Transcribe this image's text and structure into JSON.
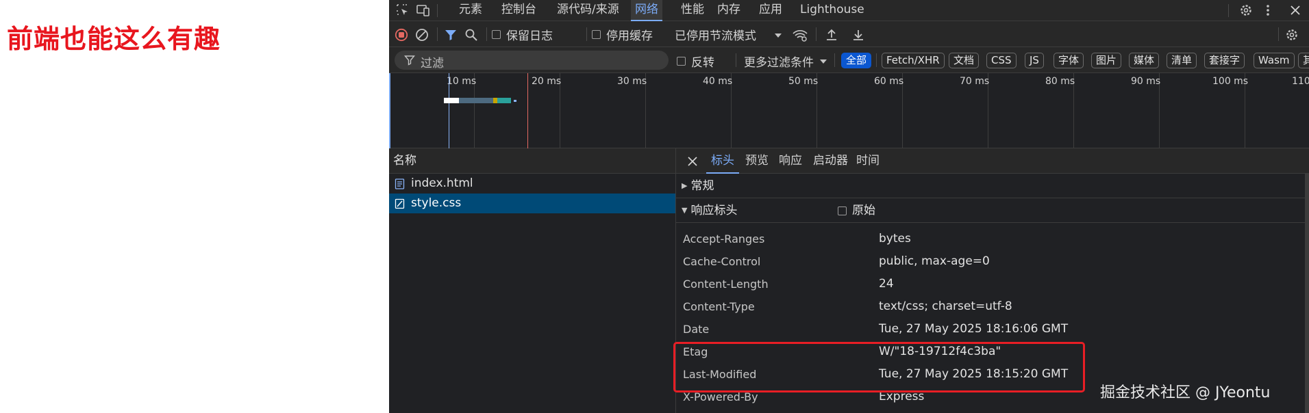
{
  "page": {
    "heading": "前端也能这么有趣"
  },
  "devtools": {
    "main_tabs": [
      {
        "label": "元素",
        "active": false
      },
      {
        "label": "控制台",
        "active": false
      },
      {
        "label": "源代码/来源",
        "active": false
      },
      {
        "label": "网络",
        "active": true
      },
      {
        "label": "性能",
        "active": false
      },
      {
        "label": "内存",
        "active": false
      },
      {
        "label": "应用",
        "active": false
      },
      {
        "label": "Lighthouse",
        "active": false
      }
    ],
    "toolbar": {
      "preserve_log": "保留日志",
      "disable_cache": "停用缓存",
      "throttling": "已停用节流模式"
    },
    "filter": {
      "placeholder": "过滤",
      "invert": "反转",
      "more_filters": "更多过滤条件",
      "types": [
        {
          "label": "全部",
          "active": true
        },
        {
          "label": "Fetch/XHR",
          "active": false
        },
        {
          "label": "文档",
          "active": false
        },
        {
          "label": "CSS",
          "active": false
        },
        {
          "label": "JS",
          "active": false
        },
        {
          "label": "字体",
          "active": false
        },
        {
          "label": "图片",
          "active": false
        },
        {
          "label": "媒体",
          "active": false
        },
        {
          "label": "清单",
          "active": false
        },
        {
          "label": "套接字",
          "active": false
        },
        {
          "label": "Wasm",
          "active": false
        },
        {
          "label": "其他",
          "active": false
        }
      ]
    },
    "timeline": {
      "ticks": [
        "10 ms",
        "20 ms",
        "30 ms",
        "40 ms",
        "50 ms",
        "60 ms",
        "70 ms",
        "80 ms",
        "90 ms",
        "100 ms",
        "110"
      ]
    },
    "requests": {
      "column_name": "名称",
      "items": [
        {
          "name": "index.html",
          "type": "document",
          "selected": false
        },
        {
          "name": "style.css",
          "type": "stylesheet",
          "selected": true
        }
      ]
    },
    "details": {
      "tabs": [
        {
          "label": "标头",
          "active": true
        },
        {
          "label": "预览",
          "active": false
        },
        {
          "label": "响应",
          "active": false
        },
        {
          "label": "启动器",
          "active": false
        },
        {
          "label": "时间",
          "active": false
        }
      ],
      "general_label": "常规",
      "response_headers_label": "响应标头",
      "raw_label": "原始",
      "headers": [
        {
          "key": "Accept-Ranges",
          "value": "bytes"
        },
        {
          "key": "Cache-Control",
          "value": "public, max-age=0"
        },
        {
          "key": "Content-Length",
          "value": "24"
        },
        {
          "key": "Content-Type",
          "value": "text/css; charset=utf-8"
        },
        {
          "key": "Date",
          "value": "Tue, 27 May 2025 18:16:06 GMT"
        },
        {
          "key": "Etag",
          "value": "W/\"18-19712f4c3ba\""
        },
        {
          "key": "Last-Modified",
          "value": "Tue, 27 May 2025 18:15:20 GMT"
        },
        {
          "key": "X-Powered-By",
          "value": "Express"
        }
      ]
    }
  },
  "watermark": "掘金技术社区 @ JYeontu",
  "colors": {
    "heading": "#e8161e",
    "accent": "#7cacf8",
    "selected_row": "#004a77",
    "highlight": "#e81e25",
    "record_stop": "#e46962"
  }
}
